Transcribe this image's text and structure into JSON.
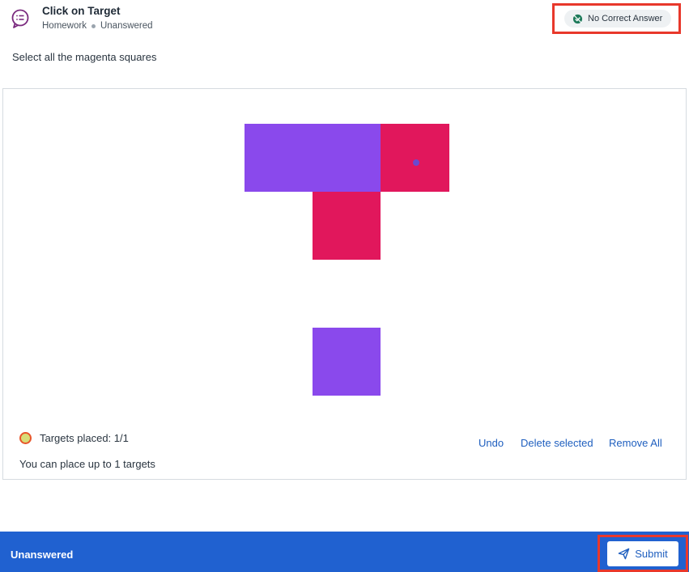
{
  "question": {
    "title": "Click on Target",
    "assignment": "Homework",
    "status": "Unanswered",
    "icon": "chat-list-icon",
    "icon_color": "#7a2a7e"
  },
  "answer_badge": {
    "label": "No Correct Answer",
    "icon": "check-off-icon",
    "icon_color": "#1d7a5a"
  },
  "prompt": "Select all the magenta squares",
  "canvas": {
    "squares": [
      {
        "color": "#8a49ec",
        "kind": "purple"
      },
      {
        "color": "#8a49ec",
        "kind": "purple"
      },
      {
        "color": "#e1175c",
        "kind": "magenta"
      },
      {
        "color": "#e1175c",
        "kind": "magenta"
      },
      {
        "color": "#8a49ec",
        "kind": "purple"
      }
    ],
    "placed_targets": 1
  },
  "targets": {
    "placed_label": "Targets placed: 1/1",
    "limit_label": "You can place up to 1 targets"
  },
  "actions": {
    "undo": "Undo",
    "delete_selected": "Delete selected",
    "remove_all": "Remove All"
  },
  "footer": {
    "status": "Unanswered",
    "submit_label": "Submit",
    "submit_icon": "paper-plane-icon",
    "bar_color": "#2061d0"
  },
  "highlight_color": "#e8382b"
}
